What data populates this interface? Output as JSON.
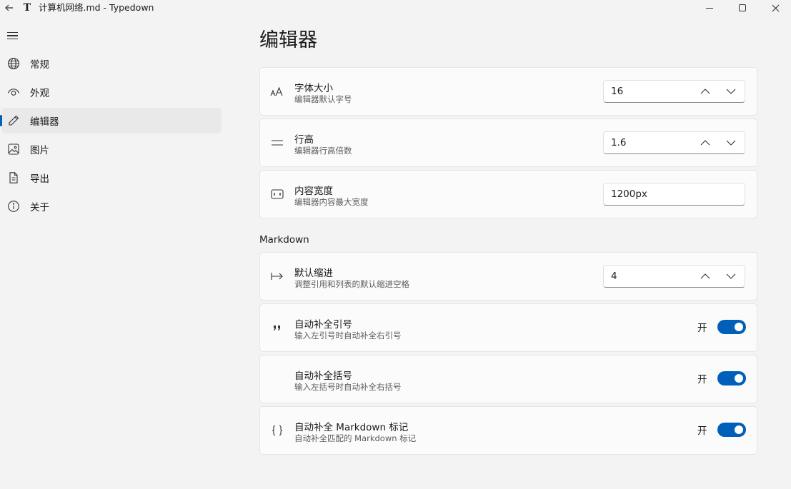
{
  "window": {
    "title": "计算机网络.md - Typedown",
    "app_icon_letter": "T"
  },
  "sidebar": {
    "items": [
      {
        "label": "常规",
        "icon": "globe-icon"
      },
      {
        "label": "外观",
        "icon": "eye-icon"
      },
      {
        "label": "编辑器",
        "icon": "pencil-icon",
        "active": true
      },
      {
        "label": "图片",
        "icon": "image-icon"
      },
      {
        "label": "导出",
        "icon": "document-icon"
      },
      {
        "label": "关于",
        "icon": "info-icon"
      }
    ]
  },
  "main": {
    "title": "编辑器",
    "settings": [
      {
        "title": "字体大小",
        "desc": "编辑器默认字号",
        "value": "16",
        "icon": "font-size-icon"
      },
      {
        "title": "行高",
        "desc": "编辑器行高倍数",
        "value": "1.6",
        "icon": "line-height-icon"
      },
      {
        "title": "内容宽度",
        "desc": "编辑器内容最大宽度",
        "value": "1200px",
        "icon": "width-icon"
      }
    ],
    "markdown_section": "Markdown",
    "markdown": [
      {
        "title": "默认缩进",
        "desc": "调整引用和列表的默认缩进空格",
        "value": "4",
        "icon": "indent-icon"
      },
      {
        "title": "自动补全引号",
        "desc": "输入左引号时自动补全右引号",
        "toggle": "开",
        "on": true,
        "icon": "quote-icon"
      },
      {
        "title": "自动补全括号",
        "desc": "输入左括号时自动补全右括号",
        "toggle": "开",
        "on": true
      },
      {
        "title": "自动补全 Markdown 标记",
        "desc": "自动补全匹配的 Markdown 标记",
        "toggle": "开",
        "on": true,
        "icon": "braces-icon"
      }
    ]
  },
  "colors": {
    "accent": "#005fb8",
    "background": "#f3f3f3",
    "card": "#fbfbfb"
  }
}
